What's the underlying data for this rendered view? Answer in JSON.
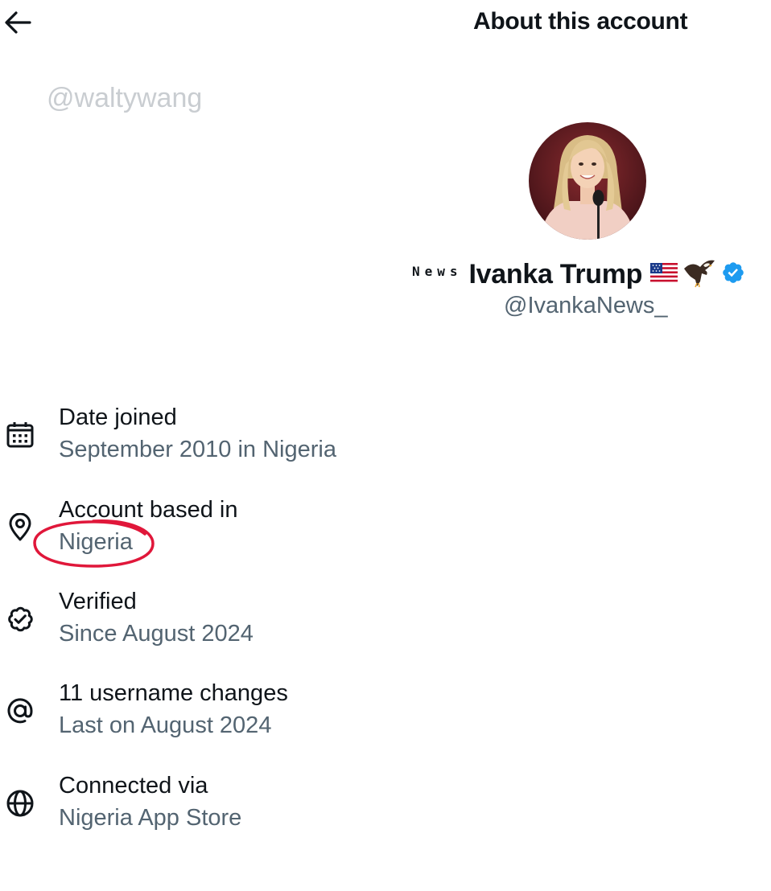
{
  "header": {
    "title": "About this account",
    "back_icon": "arrow-left-icon"
  },
  "watermark": "@waltywang",
  "profile": {
    "name_prefix": "News",
    "display_name": "Ivanka Trump",
    "emojis": [
      "us-flag-icon",
      "eagle-icon"
    ],
    "verified_badge": "verified-checkmark-icon",
    "handle": "@IvankaNews_",
    "accent_color": "#1d9bf0"
  },
  "info": [
    {
      "icon": "calendar-icon",
      "label": "Date joined",
      "value": "September 2010 in Nigeria"
    },
    {
      "icon": "location-pin-icon",
      "label": "Account based in",
      "value": "Nigeria"
    },
    {
      "icon": "verified-badge-outline-icon",
      "label": "Verified",
      "value": "Since August 2024"
    },
    {
      "icon": "at-sign-icon",
      "label": "11 username changes",
      "value": "Last on August 2024"
    },
    {
      "icon": "globe-icon",
      "label": "Connected via",
      "value": "Nigeria App Store"
    }
  ],
  "annotation": {
    "color": "#e0173a",
    "highlights": "Nigeria"
  },
  "colors": {
    "primary_text": "#0f1419",
    "secondary_text": "#536471",
    "watermark": "#c9cdd1"
  }
}
